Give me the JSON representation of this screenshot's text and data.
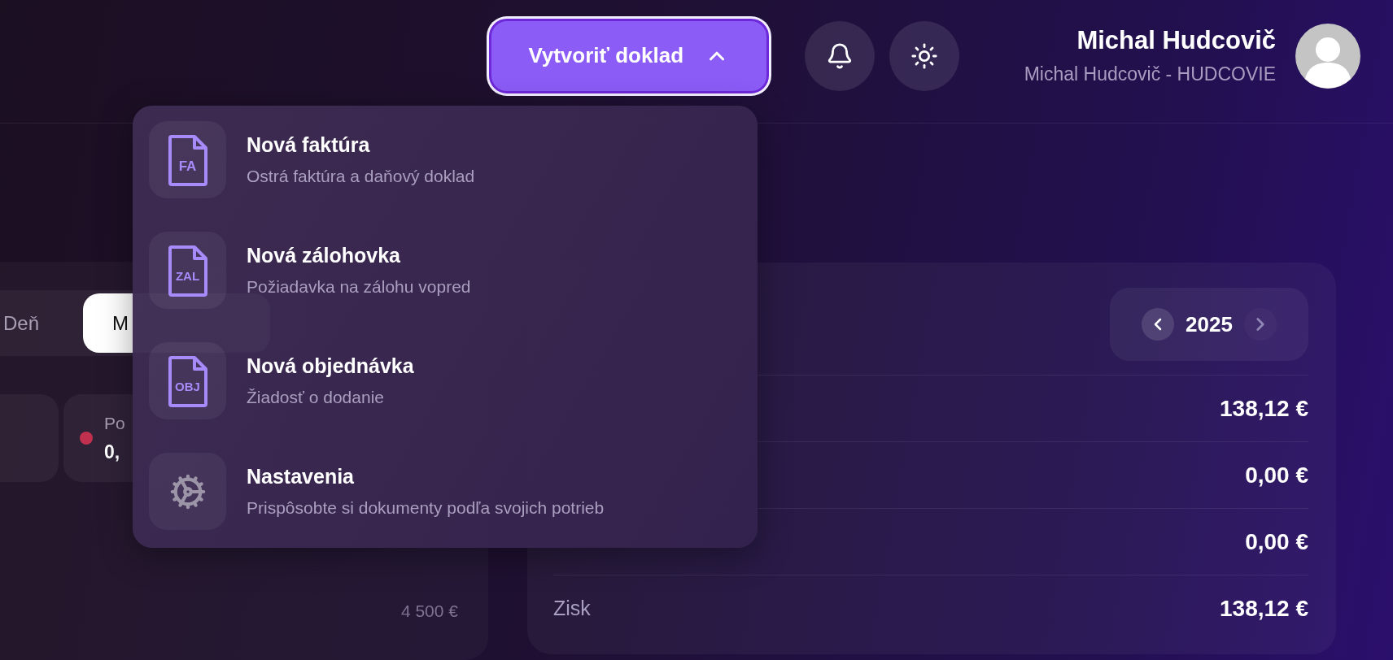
{
  "header": {
    "create_button": {
      "label": "Vytvoriť doklad",
      "expanded": true
    },
    "user": {
      "name": "Michal Hudcovič",
      "company": "Michal Hudcovič - HUDCOVIE"
    }
  },
  "create_menu": [
    {
      "kind": "document",
      "badge": "FA",
      "title": "Nová faktúra",
      "subtitle": "Ostrá faktúra a daňový doklad"
    },
    {
      "kind": "document",
      "badge": "ZAL",
      "title": "Nová zálohovka",
      "subtitle": "Požiadavka na zálohu vopred"
    },
    {
      "kind": "document",
      "badge": "OBJ",
      "title": "Nová objednávka",
      "subtitle": "Žiadosť o dodanie"
    },
    {
      "kind": "settings",
      "title": "Nastavenia",
      "subtitle": "Prispôsobte si dokumenty podľa svojich potrieb"
    }
  ],
  "period_tabs": [
    {
      "label": "Deň",
      "selected": false
    },
    {
      "label": "M",
      "selected": true
    }
  ],
  "stat_cards": [
    {
      "kind": "blank"
    },
    {
      "kind": "stat",
      "label": "Po",
      "value": "0,",
      "color": "#c2304f"
    }
  ],
  "limit_label": "4 500 €",
  "summary": {
    "year": "2025",
    "rows": [
      {
        "value": "138,12 €"
      },
      {
        "value": "0,00 €"
      },
      {
        "value": "0,00 €"
      },
      {
        "label": "Zisk",
        "value": "138,12 €"
      }
    ]
  }
}
